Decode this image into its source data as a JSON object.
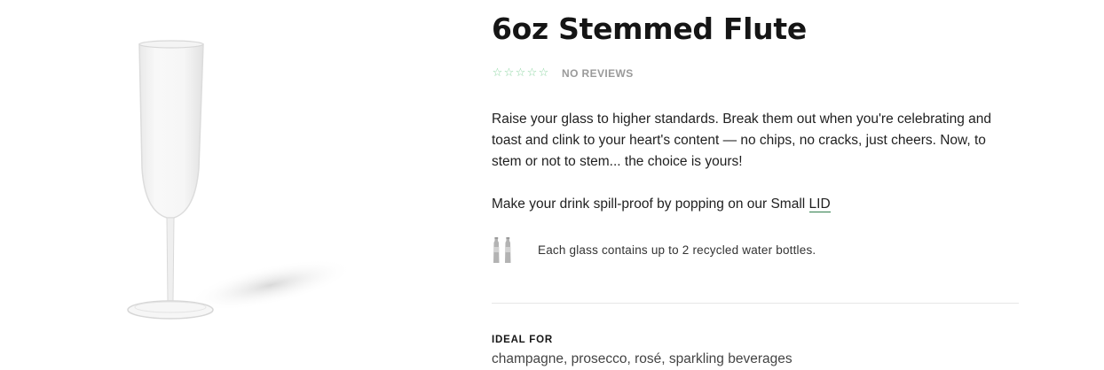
{
  "product": {
    "title": "6oz Stemmed Flute",
    "rating": {
      "stars": 0,
      "max_stars": 5,
      "label": "NO REVIEWS"
    },
    "description": "Raise your glass to higher standards. Break them out when you're celebrating and toast and clink to your heart's content — no chips, no cracks, just cheers. Now, to stem or not to stem... the choice is yours!",
    "lid_text": "Make your drink spill-proof by popping on our Small ",
    "lid_link": "LID",
    "eco_icon": "water-bottles-icon",
    "eco_text": "Each glass contains up to 2 recycled water bottles.",
    "ideal_for_label": "IDEAL FOR",
    "ideal_for_value": "champagne, prosecco, rosé, sparkling beverages"
  },
  "colors": {
    "star": "#8fd6a4",
    "link_underline": "#2e7d4a"
  }
}
